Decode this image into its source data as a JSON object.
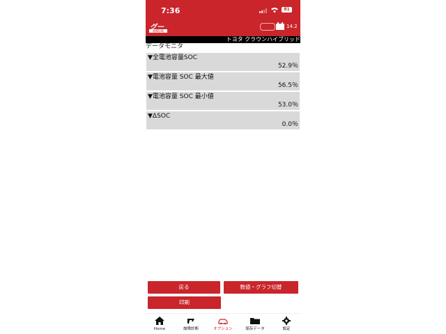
{
  "status_bar": {
    "time": "7:36",
    "battery": "81"
  },
  "header": {
    "brand_mark": "グー",
    "brand_sub": "故障診断",
    "voltage": "14.2"
  },
  "vehicle": {
    "name": "トヨタ クラウンハイブリッド"
  },
  "section_title": "データモニタ",
  "items": [
    {
      "label": "▼全電池容量SOC",
      "value": "52.9％"
    },
    {
      "label": "▼電池容量 SOC 最大値",
      "value": "56.5％"
    },
    {
      "label": "▼電池容量 SOC 最小値",
      "value": "53.0％"
    },
    {
      "label": "▼ΔSOC",
      "value": "0.0％"
    }
  ],
  "buttons": {
    "back": "戻る",
    "toggle": "数値・グラフ切替",
    "print": "印刷"
  },
  "nav": [
    {
      "label": "Home",
      "icon": "home-icon"
    },
    {
      "label": "故障診断",
      "icon": "diagnosis-icon"
    },
    {
      "label": "オプション",
      "icon": "option-car-icon"
    },
    {
      "label": "保存データ",
      "icon": "folder-icon"
    },
    {
      "label": "設定",
      "icon": "gear-icon"
    }
  ],
  "colors": {
    "brand_red": "#c9252b",
    "item_bg": "#d9d9d9",
    "vehicle_bar": "#000000"
  }
}
